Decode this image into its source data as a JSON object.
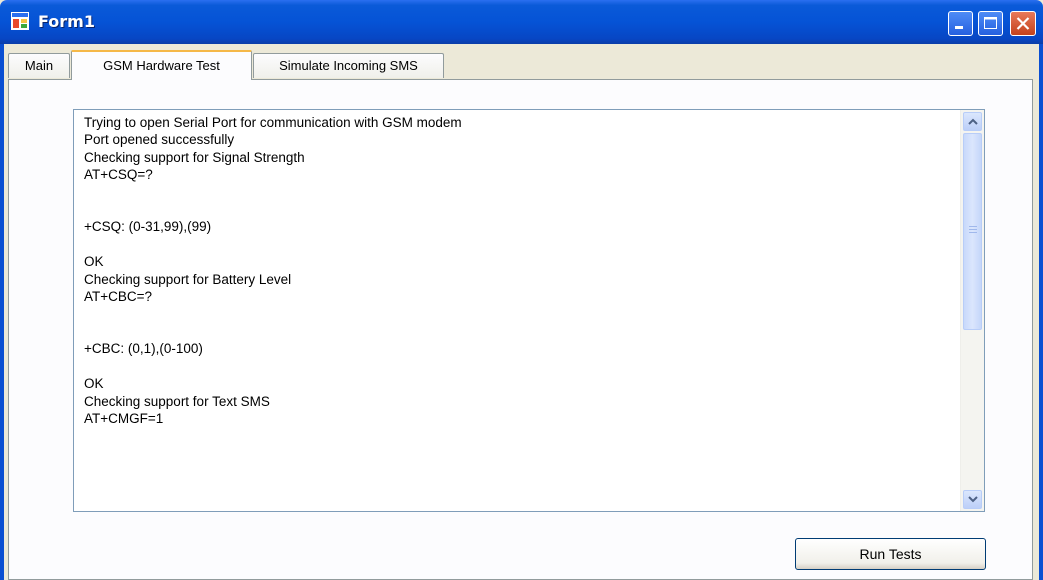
{
  "window": {
    "title": "Form1",
    "icon": "form-app-icon"
  },
  "tabs": [
    {
      "label": "Main",
      "active": false
    },
    {
      "label": "GSM Hardware Test",
      "active": true
    },
    {
      "label": "Simulate Incoming SMS",
      "active": false
    }
  ],
  "output": {
    "text": "Trying to open Serial Port for communication with GSM modem\nPort opened successfully\nChecking support for Signal Strength\nAT+CSQ=?\n\n\n+CSQ: (0-31,99),(99)\n\nOK\nChecking support for Battery Level\nAT+CBC=?\n\n\n+CBC: (0,1),(0-100)\n\nOK\nChecking support for Text SMS\nAT+CMGF=1"
  },
  "buttons": {
    "run_tests": "Run Tests"
  },
  "colors": {
    "titlebar": "#0553d6",
    "accent_tab": "#f5b848",
    "close": "#c4421c"
  }
}
